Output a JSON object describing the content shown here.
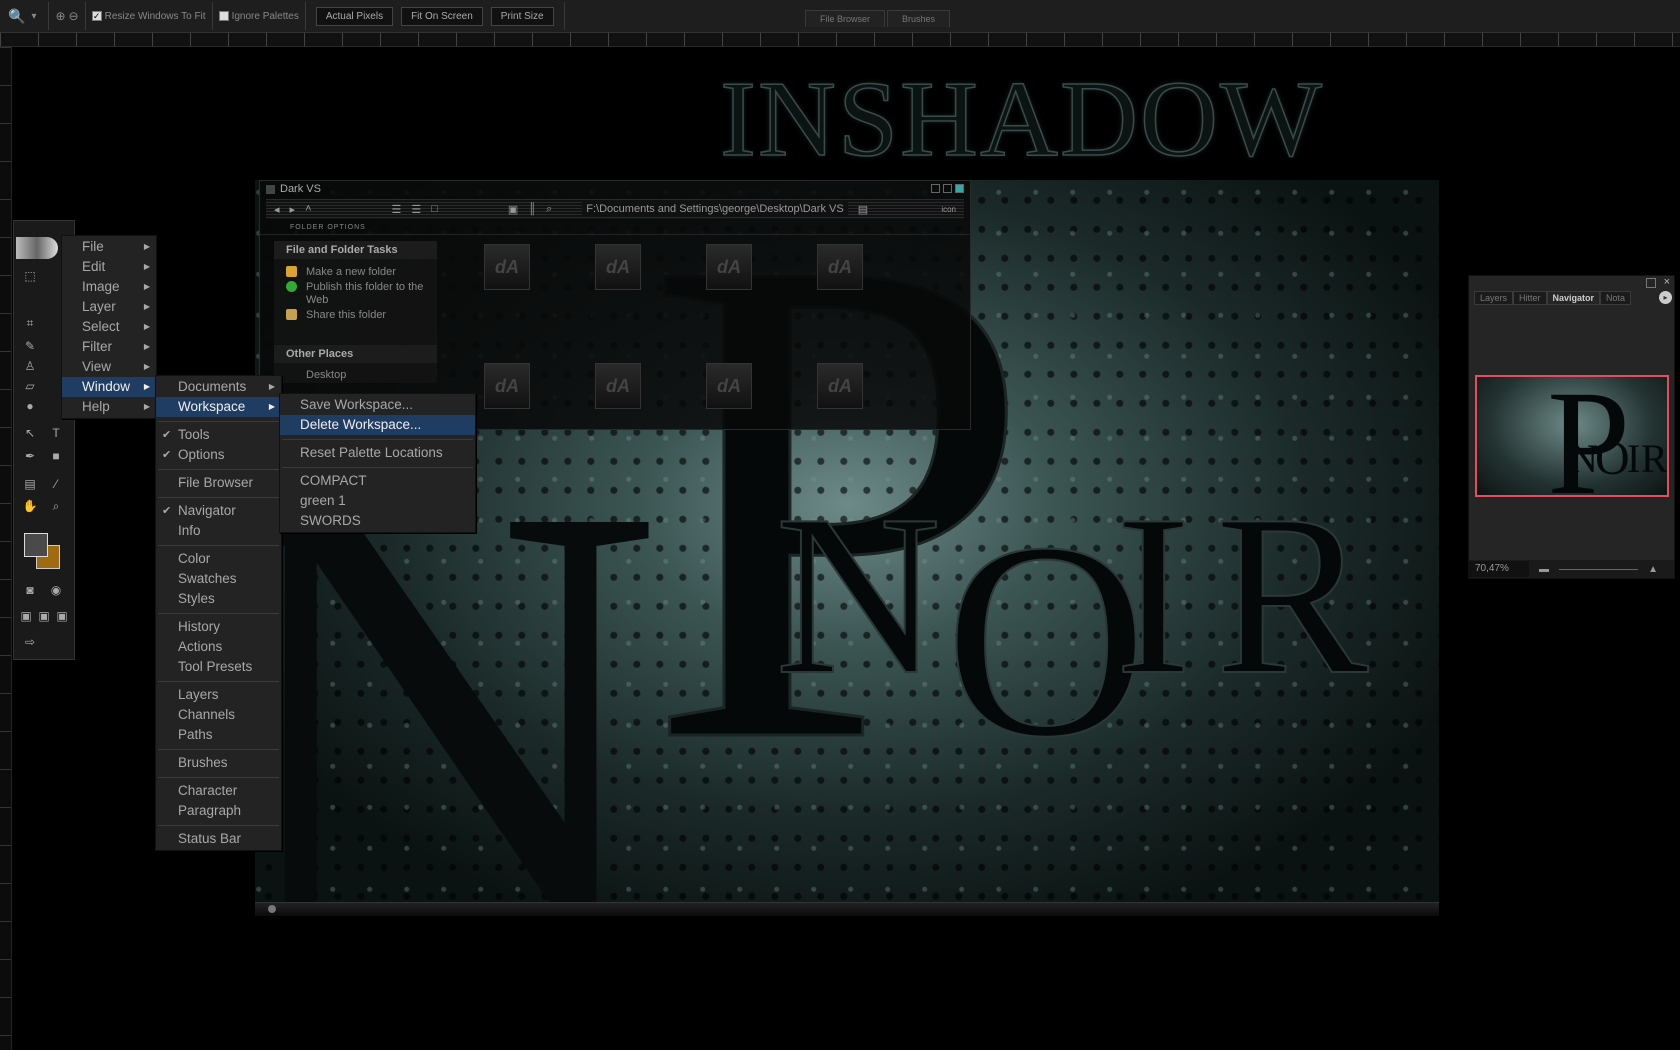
{
  "toolbar": {
    "resize_windows": "Resize Windows To Fit",
    "ignore_palettes": "Ignore Palettes",
    "actual_pixels": "Actual Pixels",
    "fit_on_screen": "Fit On Screen",
    "print_size": "Print Size",
    "resize_checked": true,
    "ignore_checked": false
  },
  "palette_well": {
    "tabs": [
      "File Browser",
      "Brushes"
    ]
  },
  "artwork": {
    "title": "INSHADOW",
    "letters": [
      "N",
      "P",
      "N",
      "O",
      "I",
      "R"
    ]
  },
  "explorer": {
    "title": "Dark VS",
    "address": "F:\\Documents and Settings\\george\\Desktop\\Dark VS",
    "view_label": "icon",
    "folder_options": "FOLDER OPTIONS",
    "tasks_header": "File and Folder Tasks",
    "tasks": [
      "Make a new folder",
      "Publish this folder to the Web",
      "Share this folder"
    ],
    "other_header": "Other Places",
    "other": [
      "Desktop"
    ],
    "icon_glyph": "dA"
  },
  "main_menu": [
    "File",
    "Edit",
    "Image",
    "Layer",
    "Select",
    "Filter",
    "View",
    "Window",
    "Help"
  ],
  "window_menu": {
    "groups": [
      [
        {
          "label": "Documents",
          "sub": true
        },
        {
          "label": "Workspace",
          "sub": true,
          "selected": true
        }
      ],
      [
        {
          "label": "Tools",
          "checked": true
        },
        {
          "label": "Options",
          "checked": true
        }
      ],
      [
        {
          "label": "File Browser"
        }
      ],
      [
        {
          "label": "Navigator",
          "checked": true
        },
        {
          "label": "Info"
        }
      ],
      [
        {
          "label": "Color"
        },
        {
          "label": "Swatches"
        },
        {
          "label": "Styles"
        }
      ],
      [
        {
          "label": "History"
        },
        {
          "label": "Actions"
        },
        {
          "label": "Tool Presets"
        }
      ],
      [
        {
          "label": "Layers"
        },
        {
          "label": "Channels"
        },
        {
          "label": "Paths"
        }
      ],
      [
        {
          "label": "Brushes"
        }
      ],
      [
        {
          "label": "Character"
        },
        {
          "label": "Paragraph"
        }
      ],
      [
        {
          "label": "Status Bar"
        }
      ]
    ]
  },
  "workspace_menu": {
    "groups": [
      [
        "Save Workspace...",
        "Delete Workspace..."
      ],
      [
        "Reset Palette Locations"
      ],
      [
        "COMPACT",
        "green 1",
        "SWORDS"
      ]
    ],
    "selected": "Delete Workspace..."
  },
  "navigator": {
    "tabs": [
      "Layers",
      "Hitter",
      "Navigator",
      "Nota"
    ],
    "active_tab": "Navigator",
    "zoom": "70,47%",
    "view_box_color": "#e84a5f"
  },
  "colors": {
    "menu_highlight": "#1f3d63",
    "foreground": "#4a4a4a",
    "background": "#a06a10"
  }
}
